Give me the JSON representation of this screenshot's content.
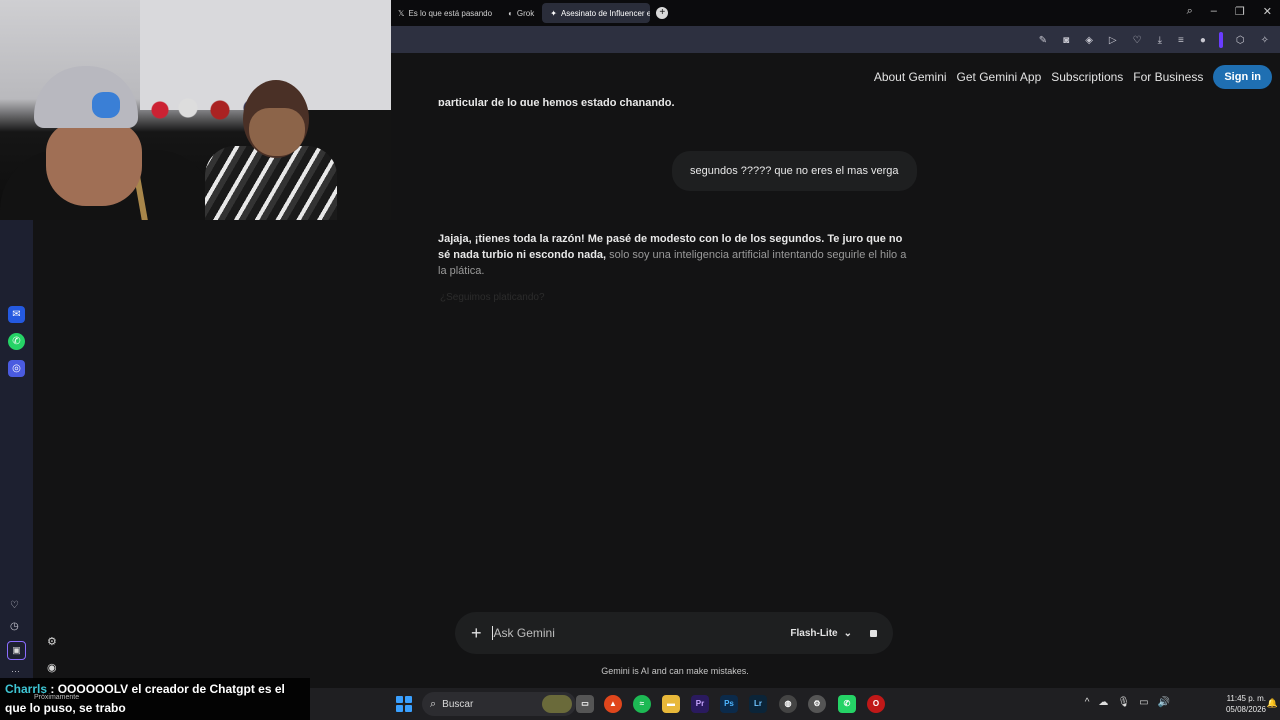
{
  "browser": {
    "tabs": [
      {
        "label": "Es lo que está pasando",
        "active": false
      },
      {
        "label": "Grok",
        "active": false
      },
      {
        "label": "Asesinato de Influencer e",
        "active": true
      }
    ],
    "new_tab": "+"
  },
  "gemini": {
    "nav": [
      "About Gemini",
      "Get Gemini App",
      "Subscriptions",
      "For Business"
    ],
    "sign_in": "Sign in",
    "cut_text": "particular de lo que hemos estado chanando.",
    "user_message": "segundos ????? que no eres el mas verga",
    "reply_bold": "Jajaja, ¡tienes toda la razón! Me pasé de modesto con lo de los segundos. Te juro que no sé nada turbio ni escondo nada,",
    "reply_faded": " solo soy una inteligencia artificial intentando seguirle el hilo a la plática.",
    "faded_line": "¿Seguimos platicando?",
    "input_placeholder": "Ask Gemini",
    "model": "Flash-Lite",
    "disclaimer": "Gemini is AI and can make mistakes."
  },
  "overlay": {
    "chat_user": "Charrls",
    "chat_message": " : OOOOOOLV el creador de Chatgpt es el que lo puso, se trabo",
    "proximo": "Próximamente"
  },
  "taskbar": {
    "search_label": "Buscar",
    "time": "11:45 p. m.",
    "date": "05/08/2026"
  },
  "colors": {
    "background": "#131314",
    "accent": "#1f6fb2",
    "chat_user": "#3fc6d4"
  }
}
